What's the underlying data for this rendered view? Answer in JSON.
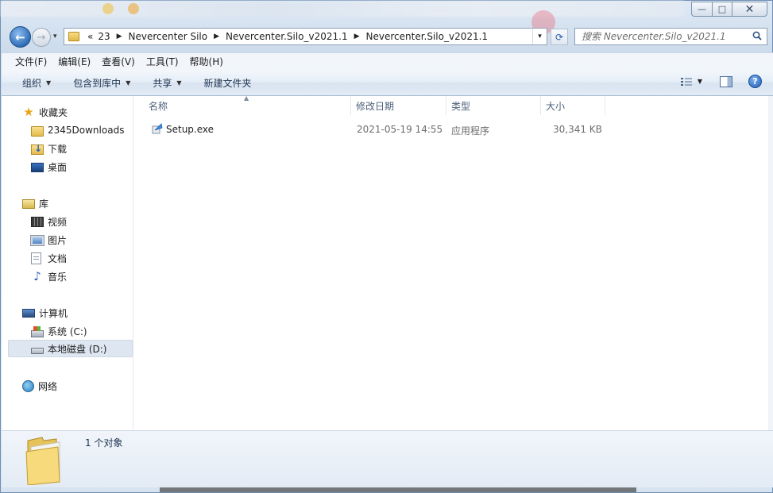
{
  "window": {
    "minimize_glyph": "—",
    "maximize_glyph": "□",
    "close_glyph": "✕"
  },
  "nav": {
    "back_glyph": "←",
    "forward_glyph": "→",
    "dropdown_glyph": "▾",
    "overflow_glyph": "«",
    "breadcrumbs": [
      "23",
      "Nevercenter Silo",
      "Nevercenter.Silo_v2021.1",
      "Nevercenter.Silo_v2021.1"
    ],
    "refresh_glyph": "⟳",
    "search_placeholder": "搜索 Nevercenter.Silo_v2021.1"
  },
  "menu": [
    "文件(F)",
    "编辑(E)",
    "查看(V)",
    "工具(T)",
    "帮助(H)"
  ],
  "commands": {
    "organize": "组织",
    "include_in_library": "包含到库中",
    "share": "共享",
    "new_folder": "新建文件夹",
    "help_glyph": "?"
  },
  "sidebar": {
    "favorites": {
      "label": "收藏夹",
      "items": [
        "2345Downloads",
        "下载",
        "桌面"
      ]
    },
    "libraries": {
      "label": "库",
      "items": [
        "视频",
        "图片",
        "文档",
        "音乐"
      ]
    },
    "computer": {
      "label": "计算机",
      "items": [
        "系统 (C:)",
        "本地磁盘 (D:)"
      ],
      "selected": "本地磁盘 (D:)"
    },
    "network": {
      "label": "网络"
    }
  },
  "columns": [
    "名称",
    "修改日期",
    "类型",
    "大小"
  ],
  "files": [
    {
      "name": "Setup.exe",
      "modified": "2021-05-19 14:55",
      "type": "应用程序",
      "size": "30,341 KB"
    }
  ],
  "details": {
    "count_text": "1 个对象"
  },
  "colors": {
    "accent": "#2f6db8",
    "selection": "#dde6f1",
    "folder": "#e4bb4c"
  }
}
